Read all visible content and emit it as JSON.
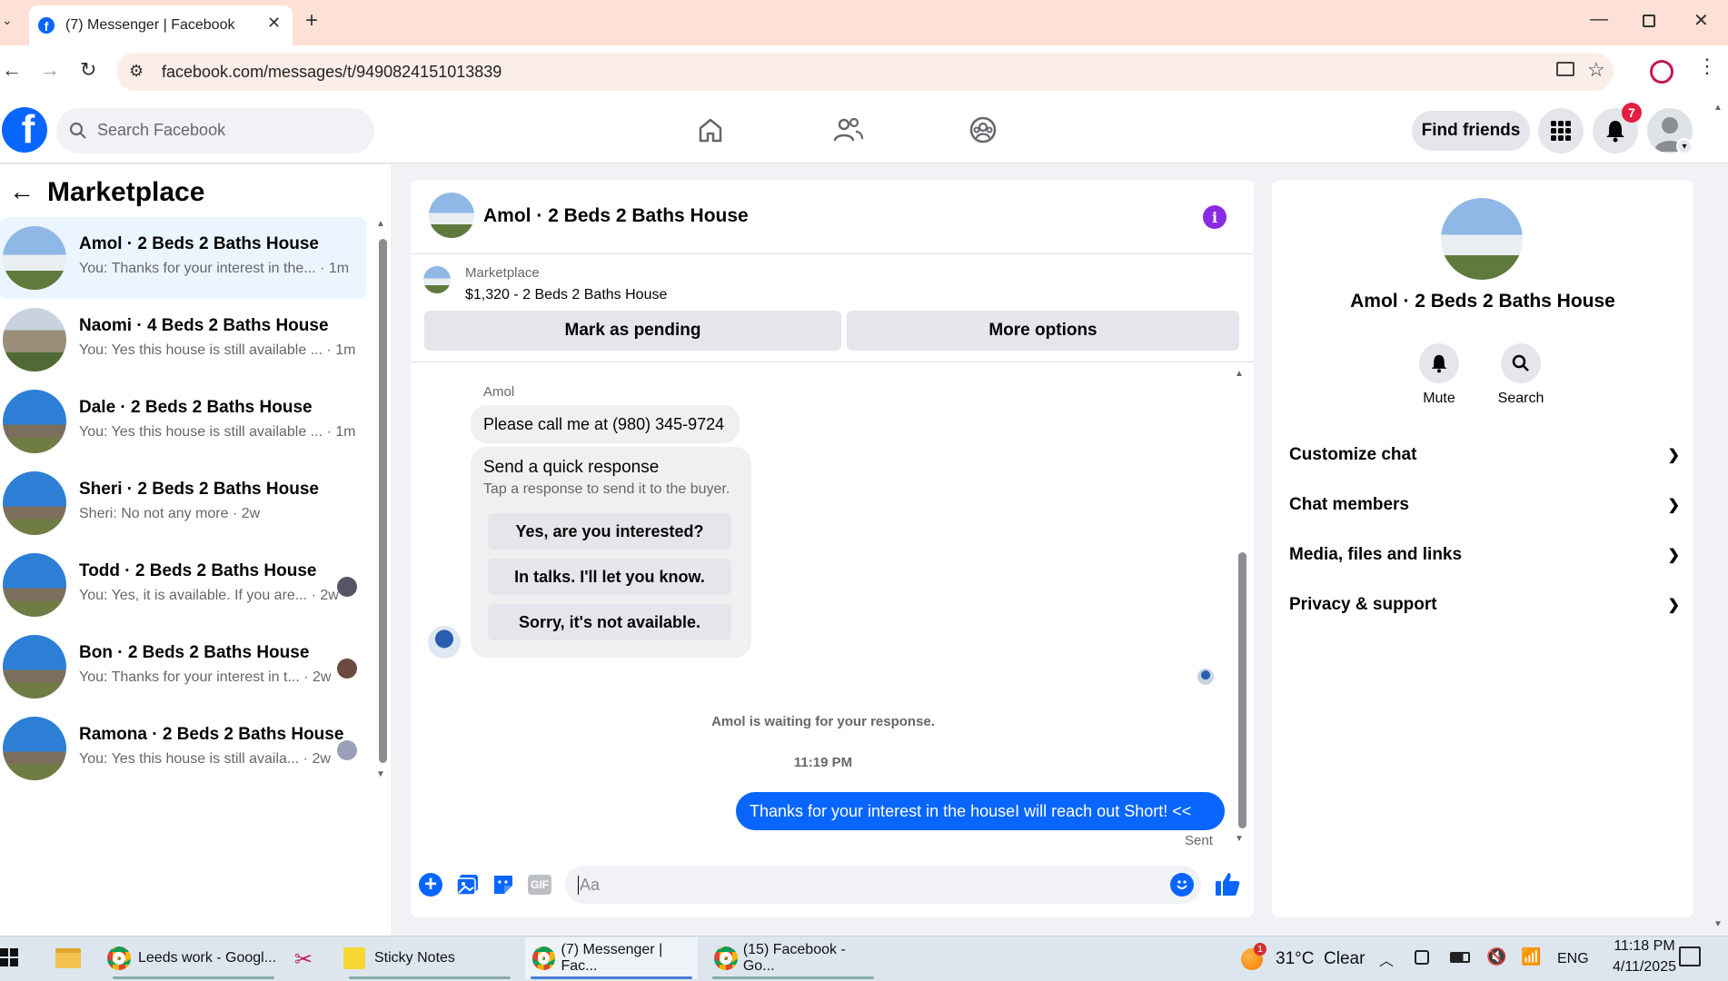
{
  "browser": {
    "tab_title": "(7) Messenger | Facebook",
    "url": "facebook.com/messages/t/9490824151013839"
  },
  "fb_header": {
    "search_placeholder": "Search Facebook",
    "find_friends": "Find friends",
    "notification_count": "7"
  },
  "left_panel": {
    "title": "Marketplace",
    "conversations": [
      {
        "name": "Amol · 2 Beds 2 Baths House",
        "preview": "You: Thanks for your interest in the... · 1m"
      },
      {
        "name": "Naomi · 4 Beds 2 Baths House",
        "preview": "You: Yes this house is still available ... · 1m"
      },
      {
        "name": "Dale · 2 Beds 2 Baths House",
        "preview": "You: Yes this house is still available ... · 1m"
      },
      {
        "name": "Sheri · 2 Beds 2 Baths House",
        "preview": "Sheri: No not any more · 2w"
      },
      {
        "name": "Todd · 2 Beds 2 Baths House",
        "preview": "You: Yes, it is available. If you are... · 2w"
      },
      {
        "name": "Bon · 2 Beds 2 Baths House",
        "preview": "You: Thanks for your interest in t... · 2w"
      },
      {
        "name": "Ramona · 2 Beds 2 Baths House",
        "preview": "You: Yes this house is still availa... · 2w"
      }
    ]
  },
  "chat": {
    "title": "Amol · 2 Beds 2 Baths House",
    "listing_label": "Marketplace",
    "listing_price": "$1,320 - 2 Beds 2 Baths House",
    "mark_pending": "Mark as pending",
    "more_options": "More options",
    "sender_name": "Amol",
    "incoming_message": "Please call me at (980) 345-9724",
    "quick_title": "Send a quick response",
    "quick_sub": "Tap a response to send it to the buyer.",
    "quick_responses": [
      "Yes, are you interested?",
      "In talks. I'll let you know.",
      "Sorry, it's not available."
    ],
    "waiting_notice": "Amol is waiting for your response.",
    "timestamp": "11:19 PM",
    "outgoing_message": "Thanks for your interest in the houseI will reach out Short! <<",
    "sent_label": "Sent",
    "composer_placeholder": "Aa"
  },
  "info_panel": {
    "title": "Amol · 2 Beds 2 Baths House",
    "mute": "Mute",
    "search": "Search",
    "sections": [
      "Customize chat",
      "Chat members",
      "Media, files and links",
      "Privacy & support"
    ]
  },
  "taskbar": {
    "items": [
      "Leeds work - Googl...",
      "Sticky Notes",
      "(7) Messenger | Fac...",
      "(15) Facebook - Go..."
    ],
    "weather": "31°C  Clear",
    "lang": "ENG",
    "time": "11:18 PM",
    "date": "4/11/2025",
    "weather_badge": "1"
  },
  "colors": {
    "fb_blue": "#0866ff",
    "info_purple": "#8a2be2",
    "notif_red": "#e41e3f"
  }
}
